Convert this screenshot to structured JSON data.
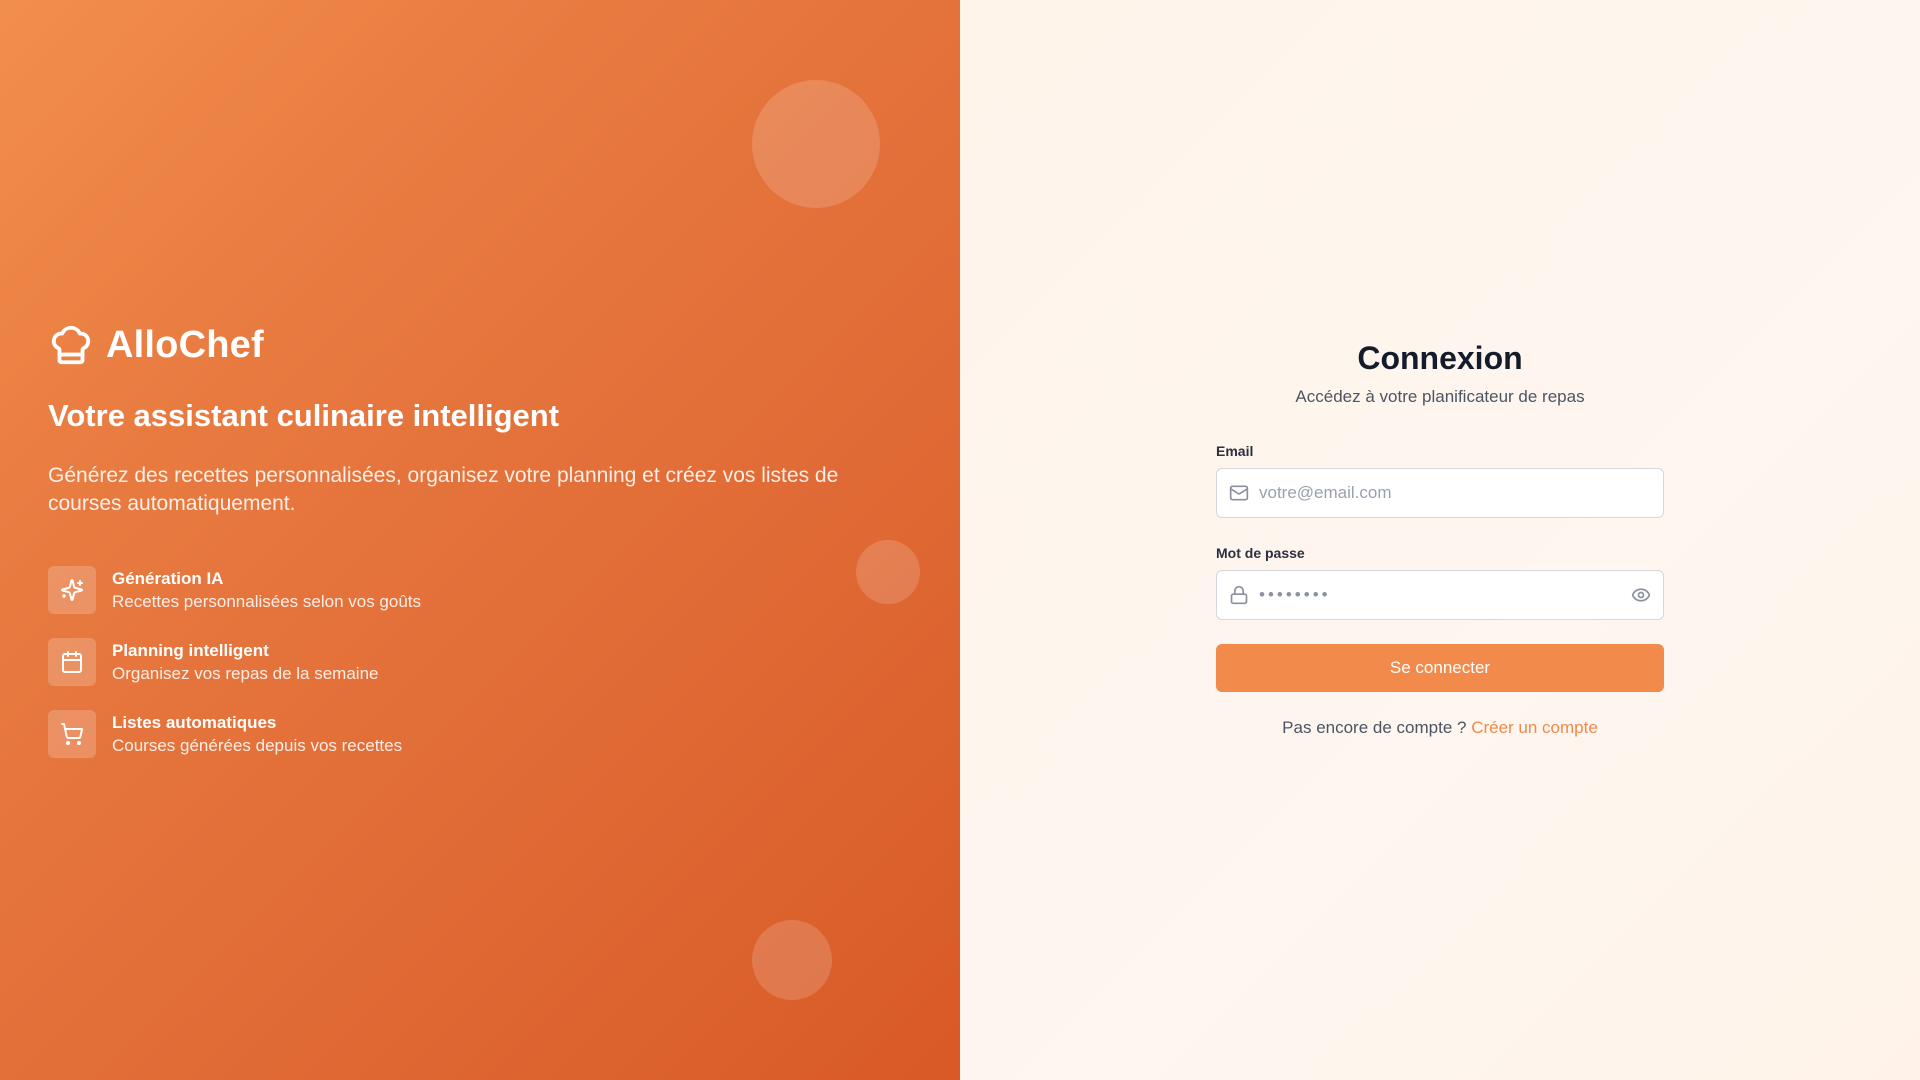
{
  "brand": {
    "name": "AlloChef",
    "icon": "chef-hat-icon"
  },
  "hero": {
    "tagline": "Votre assistant culinaire intelligent",
    "description": "Générez des recettes personnalisées, organisez votre planning et créez vos listes de courses automatiquement."
  },
  "features": [
    {
      "icon": "sparkles-icon",
      "title": "Génération IA",
      "subtitle": "Recettes personnalisées selon vos goûts"
    },
    {
      "icon": "calendar-icon",
      "title": "Planning intelligent",
      "subtitle": "Organisez vos repas de la semaine"
    },
    {
      "icon": "shopping-cart-icon",
      "title": "Listes automatiques",
      "subtitle": "Courses générées depuis vos recettes"
    }
  ],
  "login": {
    "title": "Connexion",
    "subtitle": "Accédez à votre planificateur de repas",
    "email_label": "Email",
    "email_placeholder": "votre@email.com",
    "email_value": "",
    "email_icon": "mail-icon",
    "password_label": "Mot de passe",
    "password_placeholder": "••••••••",
    "password_value": "",
    "password_icon": "lock-icon",
    "toggle_icon": "eye-icon",
    "submit_label": "Se connecter",
    "signup_prompt": "Pas encore de compte ?",
    "signup_link": "Créer un compte"
  },
  "colors": {
    "accent": "#f18a4b",
    "gradient_start": "#f28e4c",
    "gradient_end": "#d85a26",
    "right_background": "#fef6ef",
    "title_text": "#141b2b"
  }
}
